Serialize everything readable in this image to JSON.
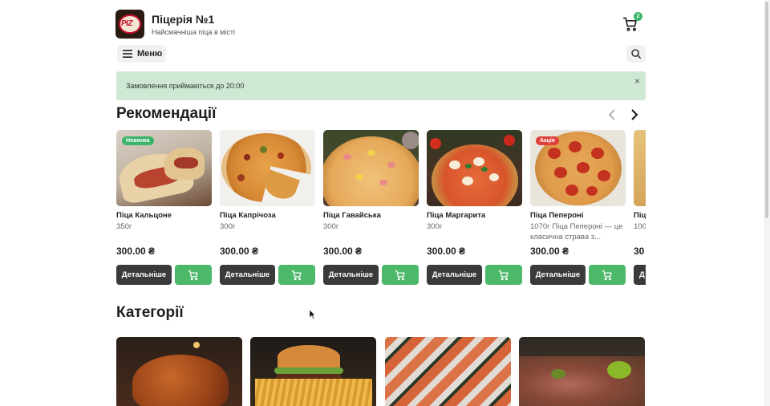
{
  "header": {
    "title": "Піцерія №1",
    "subtitle": "Найсмачніша піца в місті",
    "cart_count": "2"
  },
  "nav": {
    "menu_label": "Меню"
  },
  "banner": {
    "message": "Замовлення приймаються до 20:00",
    "close_symbol": "×"
  },
  "recommendations": {
    "title": "Рекомендації",
    "products": [
      {
        "name": "Піца Кальцоне",
        "weight": "350г",
        "description": "",
        "price": "300.00 ₴",
        "badge": "Новинка",
        "badge_color": "#3bb46b",
        "details_label": "Детальніше"
      },
      {
        "name": "Піца Капрічоза",
        "weight": "300г",
        "description": "",
        "price": "300.00 ₴",
        "badge": "",
        "badge_color": "",
        "details_label": "Детальніше"
      },
      {
        "name": "Піца Гавайська",
        "weight": "300г",
        "description": "",
        "price": "300.00 ₴",
        "badge": "",
        "badge_color": "",
        "details_label": "Детальніше"
      },
      {
        "name": "Піца Маргарита",
        "weight": "300г",
        "description": "",
        "price": "300.00 ₴",
        "badge": "",
        "badge_color": "",
        "details_label": "Детальніше"
      },
      {
        "name": "Піца Пепероні",
        "weight": "1070г",
        "description": "Піца Пепероні — це класична страва з...",
        "price": "300.00 ₴",
        "badge": "Акція",
        "badge_color": "#e0403a",
        "details_label": "Детальніше"
      },
      {
        "name": "Піц",
        "weight": "100",
        "description": "",
        "price": "30",
        "badge": "",
        "badge_color": "",
        "details_label": "Д"
      }
    ]
  },
  "categories": {
    "title": "Категорії",
    "items": [
      {
        "icon": "roast-chicken-image"
      },
      {
        "icon": "burger-fries-image"
      },
      {
        "icon": "sushi-image"
      },
      {
        "icon": "meat-platter-image"
      }
    ]
  },
  "colors": {
    "accent_green": "#4cb96a",
    "dark_button": "#3a3a3a",
    "banner_bg": "#cfe8d4"
  }
}
